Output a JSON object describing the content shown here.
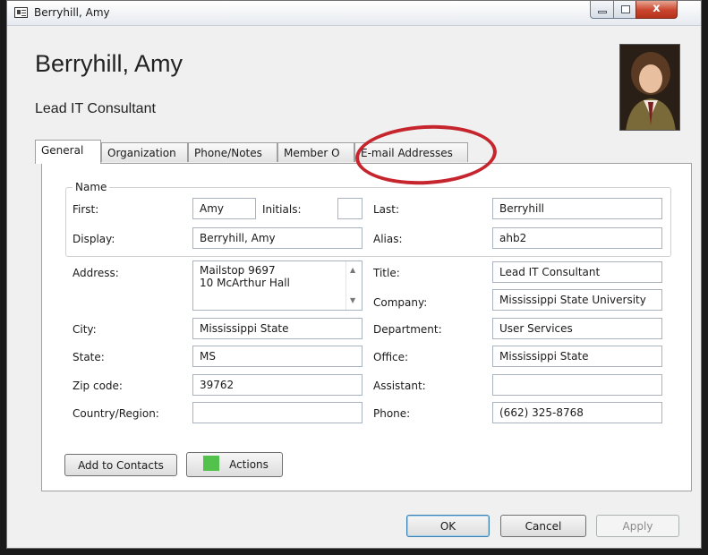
{
  "window": {
    "title": "Berryhill, Amy",
    "close_glyph": "x"
  },
  "header": {
    "display_name": "Berryhill, Amy",
    "job_title": "Lead IT Consultant",
    "photo": "contact-photo"
  },
  "tabs": [
    {
      "label": "General",
      "active": true
    },
    {
      "label": "Organization",
      "active": false
    },
    {
      "label": "Phone/Notes",
      "active": false
    },
    {
      "label": "Member O",
      "active": false
    },
    {
      "label": "E-mail Addresses",
      "active": false
    }
  ],
  "name_group": {
    "legend": "Name",
    "first_label": "First:",
    "first_value": "Amy",
    "initials_label": "Initials:",
    "initials_value": "",
    "last_label": "Last:",
    "last_value": "Berryhill",
    "display_label": "Display:",
    "display_value": "Berryhill, Amy",
    "alias_label": "Alias:",
    "alias_value": "ahb2"
  },
  "address": {
    "address_label": "Address:",
    "address_lines": [
      "Mailstop 9697",
      "10 McArthur Hall"
    ],
    "city_label": "City:",
    "city_value": "Mississippi State",
    "state_label": "State:",
    "state_value": "MS",
    "zip_label": "Zip code:",
    "zip_value": "39762",
    "country_label": "Country/Region:",
    "country_value": ""
  },
  "org": {
    "title_label": "Title:",
    "title_value": "Lead IT Consultant",
    "company_label": "Company:",
    "company_value": "Mississippi State University",
    "department_label": "Department:",
    "department_value": "User Services",
    "office_label": "Office:",
    "office_value": "Mississippi State",
    "assistant_label": "Assistant:",
    "assistant_value": "",
    "phone_label": "Phone:",
    "phone_value": "(662) 325-8768"
  },
  "panel_buttons": {
    "add_to_contacts": "Add to Contacts",
    "actions": "Actions",
    "actions_color": "#52c24c"
  },
  "dialog_buttons": {
    "ok": "OK",
    "cancel": "Cancel",
    "apply": "Apply"
  },
  "annotation": {
    "highlight_color": "#c6252e",
    "highlighted_tab": "E-mail Addresses"
  }
}
